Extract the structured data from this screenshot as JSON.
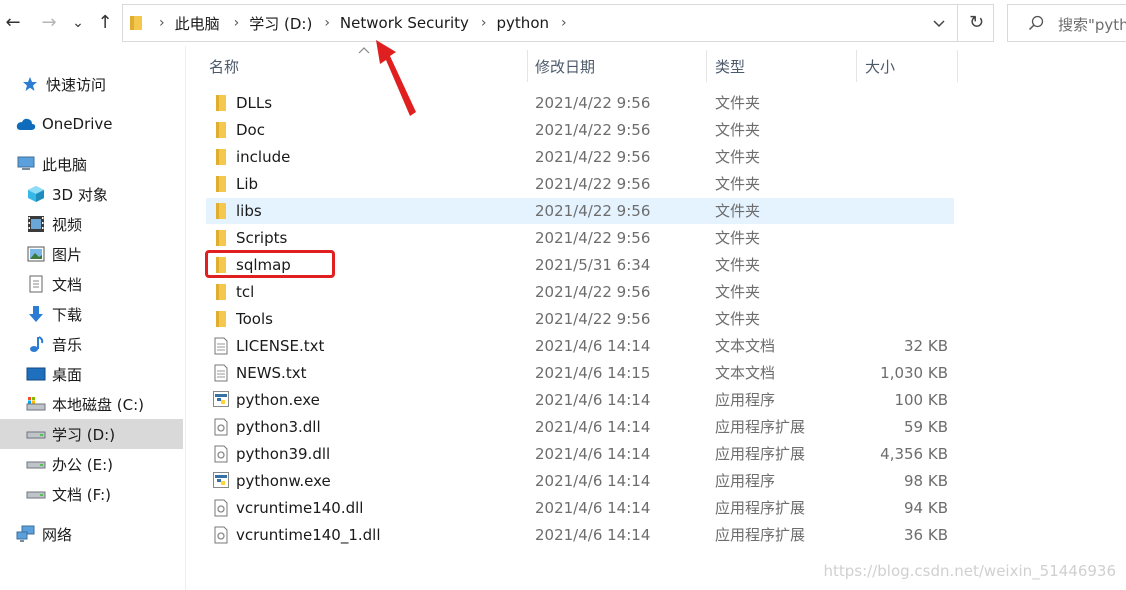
{
  "toolbar": {
    "back_icon": "←",
    "forward_icon": "→",
    "recent_icon": "⌄",
    "up_icon": "↑",
    "refresh_icon": "↻"
  },
  "address": {
    "crumbs": [
      "此电脑",
      "学习 (D:)",
      "Network Security",
      "python"
    ]
  },
  "search": {
    "placeholder": "搜索\"pyth"
  },
  "sidebar": {
    "items": [
      {
        "label": "快速访问",
        "icon": "star-icon"
      },
      {
        "label": "OneDrive",
        "icon": "cloud-icon"
      },
      {
        "label": "此电脑",
        "icon": "computer-icon"
      },
      {
        "label": "3D 对象",
        "icon": "cube-icon"
      },
      {
        "label": "视频",
        "icon": "film-icon"
      },
      {
        "label": "图片",
        "icon": "picture-icon"
      },
      {
        "label": "文档",
        "icon": "document-icon"
      },
      {
        "label": "下载",
        "icon": "download-icon"
      },
      {
        "label": "音乐",
        "icon": "music-icon"
      },
      {
        "label": "桌面",
        "icon": "desktop-icon"
      },
      {
        "label": "本地磁盘 (C:)",
        "icon": "drive-icon"
      },
      {
        "label": "学习 (D:)",
        "icon": "drive-icon"
      },
      {
        "label": "办公 (E:)",
        "icon": "drive-icon"
      },
      {
        "label": "文档 (F:)",
        "icon": "drive-icon"
      },
      {
        "label": "网络",
        "icon": "network-icon"
      }
    ]
  },
  "columns": {
    "name": "名称",
    "date": "修改日期",
    "type": "类型",
    "size": "大小"
  },
  "files": [
    {
      "name": "DLLs",
      "date": "2021/4/22 9:56",
      "type": "文件夹",
      "size": "",
      "icon": "folder-icon"
    },
    {
      "name": "Doc",
      "date": "2021/4/22 9:56",
      "type": "文件夹",
      "size": "",
      "icon": "folder-icon"
    },
    {
      "name": "include",
      "date": "2021/4/22 9:56",
      "type": "文件夹",
      "size": "",
      "icon": "folder-icon"
    },
    {
      "name": "Lib",
      "date": "2021/4/22 9:56",
      "type": "文件夹",
      "size": "",
      "icon": "folder-icon"
    },
    {
      "name": "libs",
      "date": "2021/4/22 9:56",
      "type": "文件夹",
      "size": "",
      "icon": "folder-icon"
    },
    {
      "name": "Scripts",
      "date": "2021/4/22 9:56",
      "type": "文件夹",
      "size": "",
      "icon": "folder-icon"
    },
    {
      "name": "sqlmap",
      "date": "2021/5/31 6:34",
      "type": "文件夹",
      "size": "",
      "icon": "folder-icon"
    },
    {
      "name": "tcl",
      "date": "2021/4/22 9:56",
      "type": "文件夹",
      "size": "",
      "icon": "folder-icon"
    },
    {
      "name": "Tools",
      "date": "2021/4/22 9:56",
      "type": "文件夹",
      "size": "",
      "icon": "folder-icon"
    },
    {
      "name": "LICENSE.txt",
      "date": "2021/4/6 14:14",
      "type": "文本文档",
      "size": "32 KB",
      "icon": "text-file-icon"
    },
    {
      "name": "NEWS.txt",
      "date": "2021/4/6 14:15",
      "type": "文本文档",
      "size": "1,030 KB",
      "icon": "text-file-icon"
    },
    {
      "name": "python.exe",
      "date": "2021/4/6 14:14",
      "type": "应用程序",
      "size": "100 KB",
      "icon": "python-exe-icon"
    },
    {
      "name": "python3.dll",
      "date": "2021/4/6 14:14",
      "type": "应用程序扩展",
      "size": "59 KB",
      "icon": "dll-file-icon"
    },
    {
      "name": "python39.dll",
      "date": "2021/4/6 14:14",
      "type": "应用程序扩展",
      "size": "4,356 KB",
      "icon": "dll-file-icon"
    },
    {
      "name": "pythonw.exe",
      "date": "2021/4/6 14:14",
      "type": "应用程序",
      "size": "98 KB",
      "icon": "python-exe-icon"
    },
    {
      "name": "vcruntime140.dll",
      "date": "2021/4/6 14:14",
      "type": "应用程序扩展",
      "size": "94 KB",
      "icon": "dll-file-icon"
    },
    {
      "name": "vcruntime140_1.dll",
      "date": "2021/4/6 14:14",
      "type": "应用程序扩展",
      "size": "36 KB",
      "icon": "dll-file-icon"
    }
  ],
  "watermark": "https://blog.csdn.net/weixin_51446936",
  "colors": {
    "folder": "#f4c84e",
    "hover_row": "#e5f3ff",
    "selected_sidebar": "#d9d9d9",
    "highlight_box": "#e02020",
    "annotation_arrow": "#e02020"
  }
}
